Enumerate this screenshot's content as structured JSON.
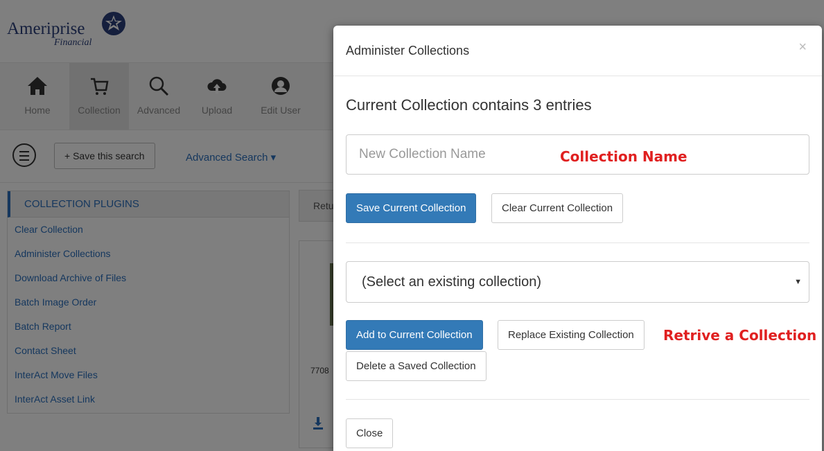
{
  "brand": {
    "name": "Ameriprise",
    "sub": "Financial"
  },
  "nav": [
    {
      "label": "Home",
      "icon": "home-icon"
    },
    {
      "label": "Collection",
      "icon": "cart-icon"
    },
    {
      "label": "Advanced",
      "icon": "search-icon"
    },
    {
      "label": "Upload",
      "icon": "cloud-upload-icon"
    },
    {
      "label": "Edit User",
      "icon": "user-icon"
    }
  ],
  "toolbar": {
    "save_search_label": "+ Save this search",
    "advanced_search_label": "Advanced Search ▾"
  },
  "plugins": {
    "header": "COLLECTION PLUGINS",
    "items": [
      "Clear Collection",
      "Administer Collections",
      "Download Archive of Files",
      "Batch Image Order",
      "Batch Report",
      "Contact Sheet",
      "InterAct Move Files",
      "InterAct Asset Link"
    ]
  },
  "background": {
    "tab_label": "Retu",
    "card_id": "7708"
  },
  "modal": {
    "title": "Administer Collections",
    "close_symbol": "×",
    "entries_text": "Current Collection contains 3 entries",
    "name_placeholder": "New Collection Name",
    "name_note": "Collection Name",
    "save_button": "Save Current Collection",
    "clear_button": "Clear Current Collection",
    "select_value": "(Select an existing collection)",
    "add_button": "Add to Current Collection",
    "replace_button": "Replace Existing Collection",
    "retrieve_note": "Retrive a Collection",
    "delete_button": "Delete a Saved Collection",
    "close_button": "Close"
  },
  "colors": {
    "primary": "#337ab7",
    "link": "#2a6fbd",
    "annotation": "#e02020",
    "brand": "#2a3f7a"
  }
}
